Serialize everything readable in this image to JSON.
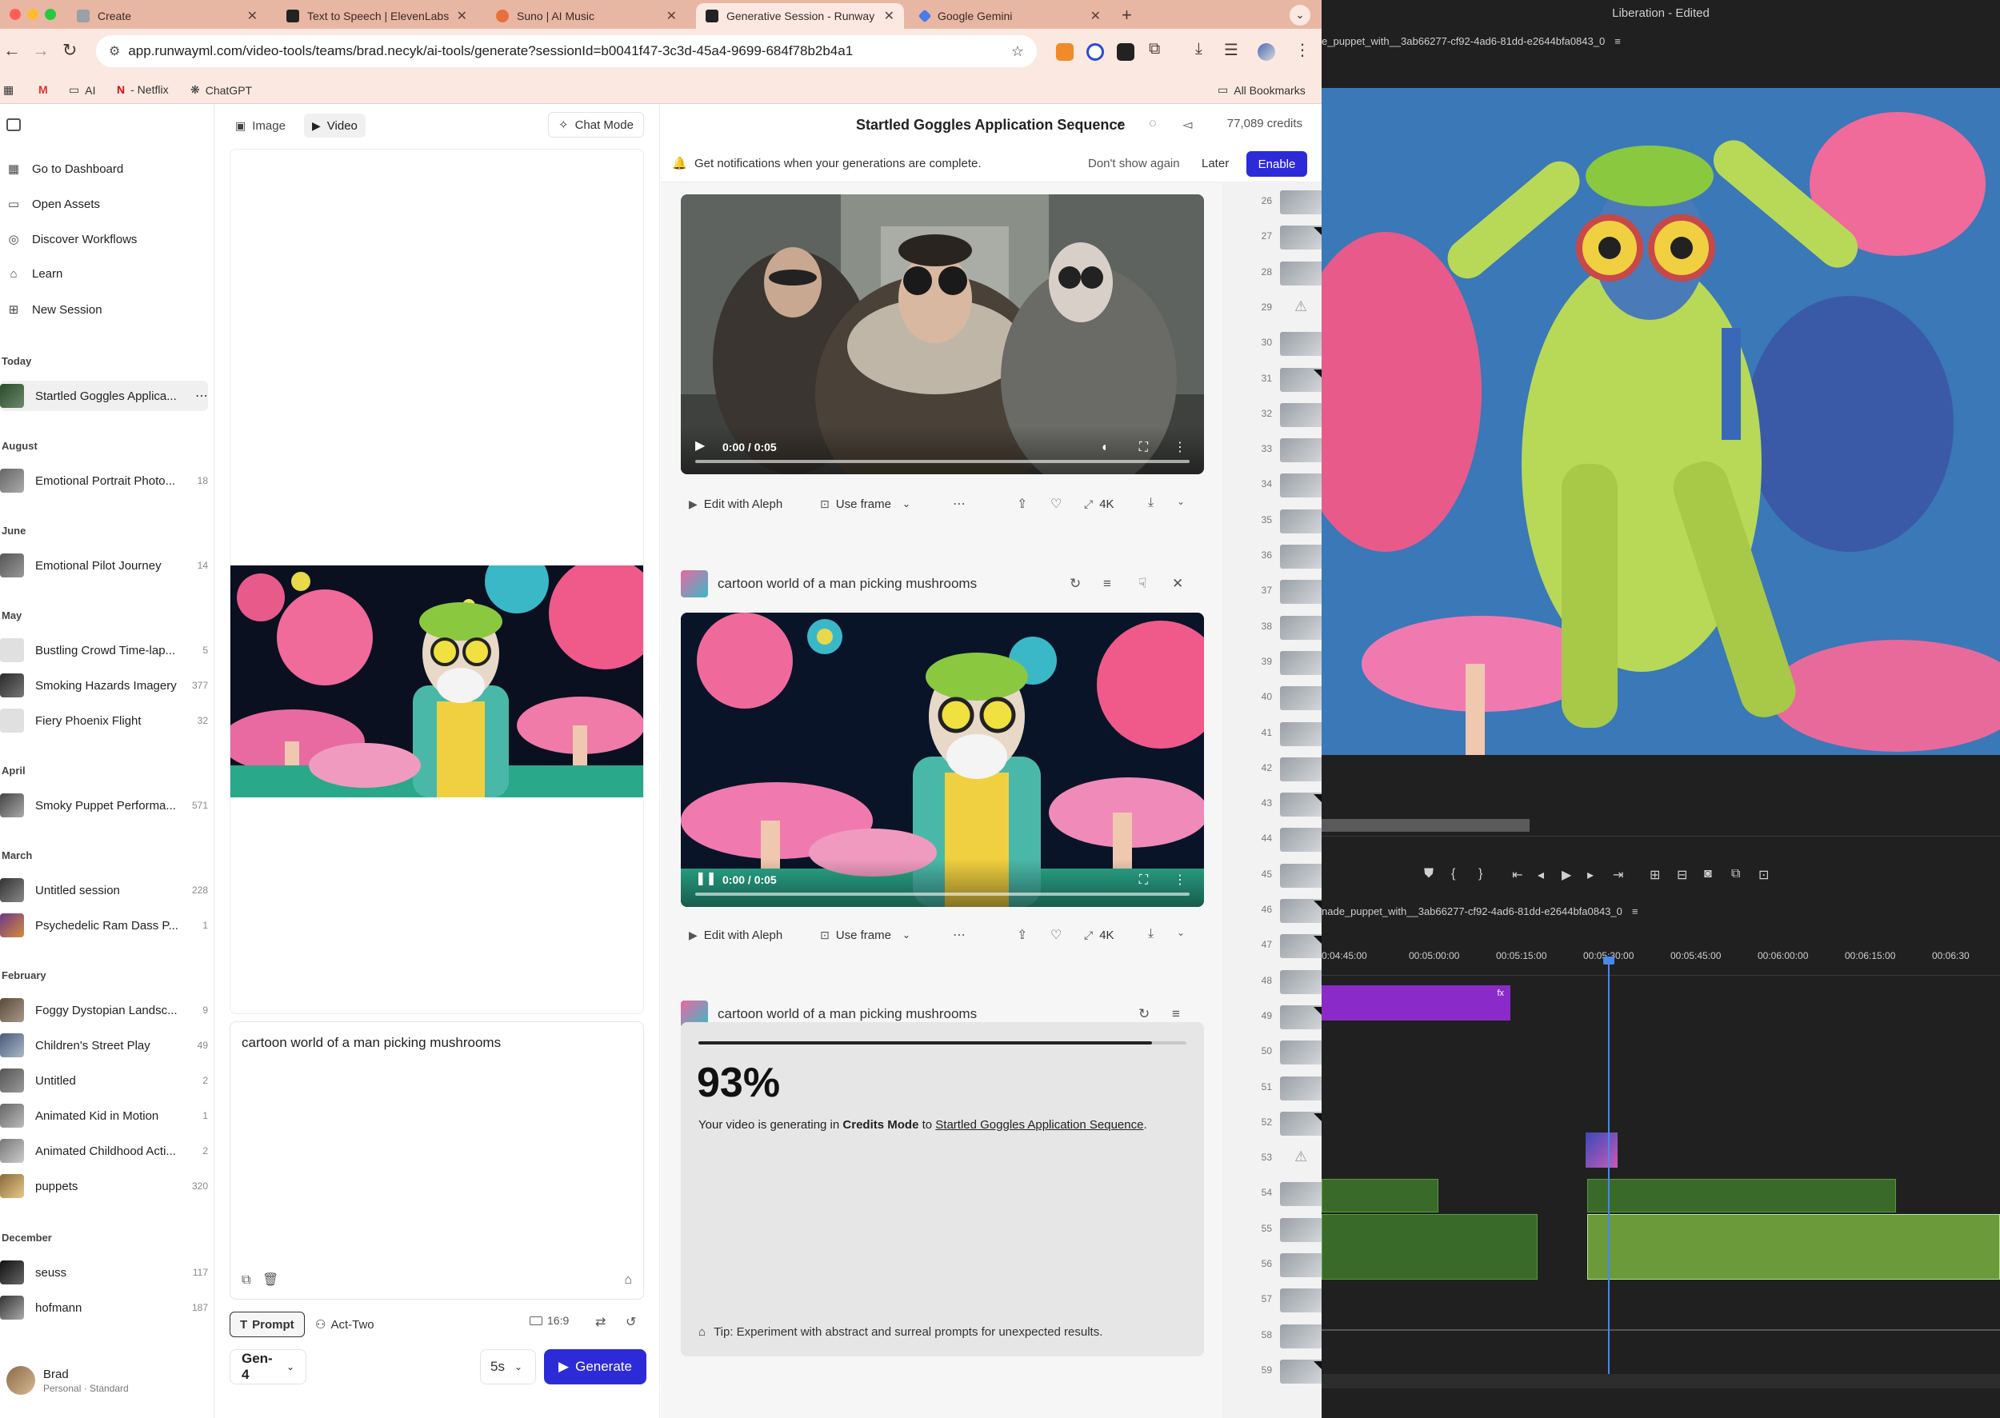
{
  "browser": {
    "tabs": [
      {
        "label": "Create",
        "fav_color": "#9aa0a6"
      },
      {
        "label": "Text to Speech | ElevenLabs",
        "fav_color": "#222222"
      },
      {
        "label": "Suno | AI Music",
        "fav_color": "#e8703a"
      },
      {
        "label": "Generative Session - Runway",
        "fav_color": "#222222"
      },
      {
        "label": "Google Gemini",
        "fav_color": "#4a7be8"
      }
    ],
    "url": "app.runwayml.com/video-tools/teams/brad.necyk/ai-tools/generate?sessionId=b0041f47-3c3d-45a4-9699-684f78b2b4a1",
    "bookmarks": [
      "AI",
      "- Netflix",
      "ChatGPT"
    ],
    "all_bookmarks": "All Bookmarks"
  },
  "sidebar": {
    "nav": [
      {
        "label": "Go to Dashboard",
        "icon": "grid-icon"
      },
      {
        "label": "Open Assets",
        "icon": "folder-icon"
      },
      {
        "label": "Discover Workflows",
        "icon": "globe-icon"
      },
      {
        "label": "Learn",
        "icon": "graduation-cap-icon"
      },
      {
        "label": "New Session",
        "icon": "plus-square-icon"
      }
    ],
    "groups": [
      {
        "label": "Today",
        "items": [
          {
            "name": "Startled Goggles Applica...",
            "count": "",
            "active": true
          }
        ]
      },
      {
        "label": "August",
        "items": [
          {
            "name": "Emotional Portrait Photo...",
            "count": "18"
          }
        ]
      },
      {
        "label": "June",
        "items": [
          {
            "name": "Emotional Pilot Journey",
            "count": "14"
          }
        ]
      },
      {
        "label": "May",
        "items": [
          {
            "name": "Bustling Crowd Time-lap...",
            "count": "5"
          },
          {
            "name": "Smoking Hazards Imagery",
            "count": "377"
          },
          {
            "name": "Fiery Phoenix Flight",
            "count": "32"
          }
        ]
      },
      {
        "label": "April",
        "items": [
          {
            "name": "Smoky Puppet Performa...",
            "count": "571"
          }
        ]
      },
      {
        "label": "March",
        "items": [
          {
            "name": "Untitled session",
            "count": "228"
          },
          {
            "name": "Psychedelic Ram Dass P...",
            "count": "1"
          }
        ]
      },
      {
        "label": "February",
        "items": [
          {
            "name": "Foggy Dystopian Landsc...",
            "count": "9"
          },
          {
            "name": "Children's Street Play",
            "count": "49"
          },
          {
            "name": "Untitled",
            "count": "2"
          },
          {
            "name": "Animated Kid in Motion",
            "count": "1"
          },
          {
            "name": "Animated Childhood Acti...",
            "count": "2"
          },
          {
            "name": "puppets",
            "count": "320"
          }
        ]
      },
      {
        "label": "December",
        "items": [
          {
            "name": "seuss",
            "count": "117"
          },
          {
            "name": "hofmann",
            "count": "187"
          }
        ]
      }
    ],
    "user": {
      "name": "Brad",
      "plan": "Personal · Standard"
    }
  },
  "panel": {
    "tabs": [
      "Image",
      "Video"
    ],
    "active_tab": "Video",
    "chat_mode": "Chat Mode",
    "prompt": "cartoon world of a man picking mushrooms",
    "modes": [
      "Prompt",
      "Act-Two"
    ],
    "ratio": "16:9",
    "model": "Gen-4",
    "duration": "5s",
    "generate": "Generate"
  },
  "main": {
    "session_title": "Startled Goggles Application Sequence",
    "credits": "77,089 credits",
    "notification": {
      "text": "Get notifications when your generations are complete.",
      "dismiss": "Don't show again",
      "later": "Later",
      "enable": "Enable"
    },
    "video_time": "0:00 / 0:05",
    "actions": {
      "edit": "Edit with Aleph",
      "use_frame": "Use frame",
      "upscale": "4K"
    },
    "generations": [
      {
        "prompt": "cartoon world of a man picking mushrooms"
      },
      {
        "prompt": "cartoon world of a man picking mushrooms"
      }
    ],
    "progress": {
      "percent": "93%",
      "fraction": 0.93,
      "msg_pre": "Your video is generating in ",
      "msg_mode": "Credits Mode",
      "msg_mid": " to ",
      "msg_session": "Startled Goggles Application Sequence",
      "msg_end": ".",
      "tip": "Tip: Experiment with abstract and surreal prompts for unexpected results."
    },
    "rail": [
      {
        "n": "26"
      },
      {
        "n": "27",
        "corner": true
      },
      {
        "n": "28"
      },
      {
        "n": "29",
        "warn": true
      },
      {
        "n": "30"
      },
      {
        "n": "31",
        "corner": true
      },
      {
        "n": "32"
      },
      {
        "n": "33"
      },
      {
        "n": "34"
      },
      {
        "n": "35"
      },
      {
        "n": "36"
      },
      {
        "n": "37"
      },
      {
        "n": "38"
      },
      {
        "n": "39"
      },
      {
        "n": "40"
      },
      {
        "n": "41"
      },
      {
        "n": "42"
      },
      {
        "n": "43",
        "corner": true
      },
      {
        "n": "44"
      },
      {
        "n": "45"
      },
      {
        "n": "46",
        "corner": true
      },
      {
        "n": "47",
        "corner": true
      },
      {
        "n": "48"
      },
      {
        "n": "49",
        "corner": true
      },
      {
        "n": "50"
      },
      {
        "n": "51"
      },
      {
        "n": "52",
        "corner": true
      },
      {
        "n": "53",
        "warn": true
      },
      {
        "n": "54"
      },
      {
        "n": "55"
      },
      {
        "n": "56"
      },
      {
        "n": "57"
      },
      {
        "n": "58"
      },
      {
        "n": "59",
        "corner": true
      }
    ]
  },
  "premiere": {
    "title": "Liberation - Edited",
    "monitor_name": "e_puppet_with__3ab66277-cf92-4ad6-81dd-e2644bfa0843_0",
    "sequence_name": "nade_puppet_with__3ab66277-cf92-4ad6-81dd-e2644bfa0843_0",
    "ruler": [
      "0:04:45:00",
      "00:05:00:00",
      "00:05:15:00",
      "00:05:30:00",
      "00:05:45:00",
      "00:06:00:00",
      "00:06:15:00",
      "00:06:30"
    ]
  }
}
